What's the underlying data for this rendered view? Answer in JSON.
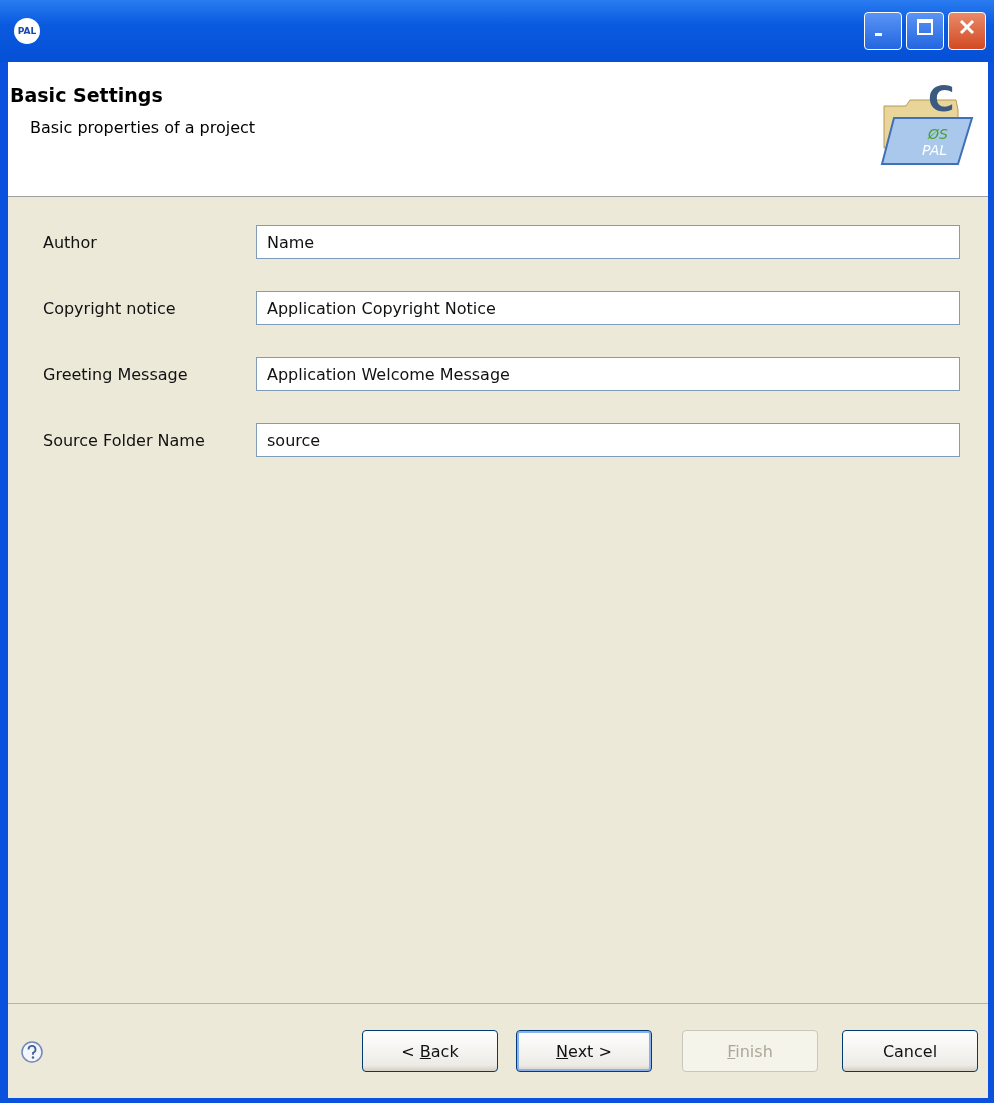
{
  "window": {
    "app_badge": "PAL",
    "controls": [
      {
        "kind": "minimize"
      },
      {
        "kind": "maximize"
      },
      {
        "kind": "close"
      }
    ]
  },
  "header": {
    "title": "Basic Settings",
    "description": "Basic properties of a project",
    "logo": {
      "letter": "C",
      "mark": "ØS",
      "brand": "PAL"
    }
  },
  "fields": [
    {
      "label": "Author",
      "value": "Name"
    },
    {
      "label": "Copyright notice",
      "value": "Application Copyright Notice"
    },
    {
      "label": "Greeting Message",
      "value": "Application Welcome Message"
    },
    {
      "label": "Source Folder Name",
      "value": "source"
    }
  ],
  "buttons": [
    {
      "prefix": "< ",
      "key": "B",
      "rest": "ack",
      "disabled": false,
      "default": false
    },
    {
      "key": "N",
      "rest": "ext >",
      "disabled": false,
      "default": true
    },
    {
      "key": "F",
      "rest": "inish",
      "disabled": true,
      "default": false
    },
    {
      "prefix": "Cancel",
      "disabled": false,
      "default": false
    }
  ]
}
